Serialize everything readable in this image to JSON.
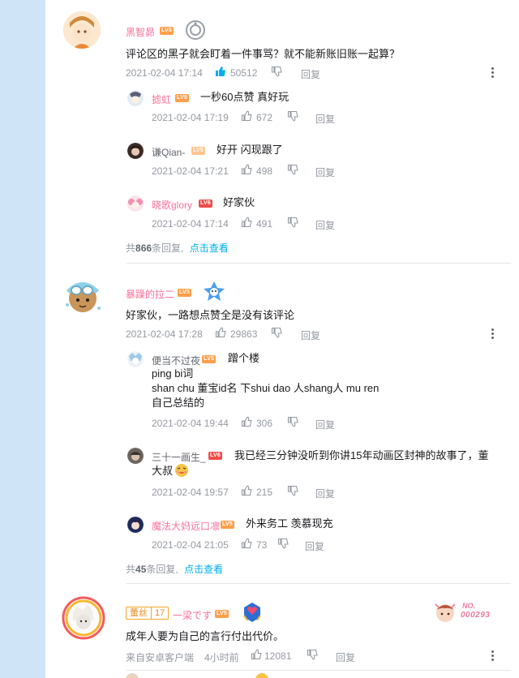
{
  "comments": [
    {
      "username": "黑智昴",
      "level": "LV5",
      "text": "评论区的黑子就会盯着一件事骂？就不能新账旧账一起算？",
      "time": "2021-02-04 17:14",
      "likes": "50512",
      "reply_label": "回复",
      "replies": [
        {
          "username": "摅虹",
          "level": "LV5",
          "text": "一秒60点赞 真好玩",
          "time": "2021-02-04 17:19",
          "likes": "672",
          "reply_label": "回复"
        },
        {
          "username": "谦Qian-",
          "level": "LV5",
          "text": "好开 闪现跟了",
          "time": "2021-02-04 17:21",
          "likes": "498",
          "reply_label": "回复"
        },
        {
          "username": "晓歌glory",
          "level": "LV6",
          "text": "好家伙",
          "time": "2021-02-04 17:14",
          "likes": "491",
          "reply_label": "回复"
        }
      ],
      "summary_prefix": "共",
      "summary_count": "866",
      "summary_suffix": "条回复,",
      "summary_link": "点击查看"
    },
    {
      "username": "暴躁的拉二",
      "level": "LV5",
      "text": "好家伙，一路想点赞全是没有该评论",
      "time": "2021-02-04 17:28",
      "likes": "29863",
      "reply_label": "回复",
      "replies": [
        {
          "username": "便当不过夜",
          "level": "LV5",
          "text_lines": [
            "蹭个楼",
            "ping bi词",
            "shan chu 董宝id名 下shui dao 人shang人 mu ren",
            "自己总结的"
          ],
          "time": "2021-02-04 19:44",
          "likes": "306",
          "reply_label": "回复"
        },
        {
          "username": "三十一画生_",
          "level": "LV6",
          "text_lines": [
            "我已经三分钟没听到你讲15年动画区封神的故事了，董",
            "大叔"
          ],
          "time": "2021-02-04 19:57",
          "likes": "215",
          "reply_label": "回复"
        },
        {
          "username": "魔法大妈远口凛",
          "level": "LV5",
          "text": "外来务工 羡慕现充",
          "time": "2021-02-04 21:05",
          "likes": "73",
          "reply_label": "回复"
        }
      ],
      "summary_prefix": "共",
      "summary_count": "45",
      "summary_suffix": "条回复,",
      "summary_link": "点击查看"
    },
    {
      "fan_badge_name": "蕾丝",
      "fan_badge_level": "17",
      "username": "一梁です",
      "level": "LV5",
      "no_label": "NO.",
      "no_number": "000293",
      "text": "成年人要为自己的言行付出代价。",
      "device": "来自安卓客户端",
      "time": "4小时前",
      "likes": "12081",
      "reply_label": "回复"
    }
  ],
  "colors": {
    "username_pink": "#fb7299",
    "level5": "#ff9f4a",
    "level6": "#f04c49",
    "link": "#00aeec",
    "like_active": "#00aeec",
    "background": "#cfe4f7"
  }
}
